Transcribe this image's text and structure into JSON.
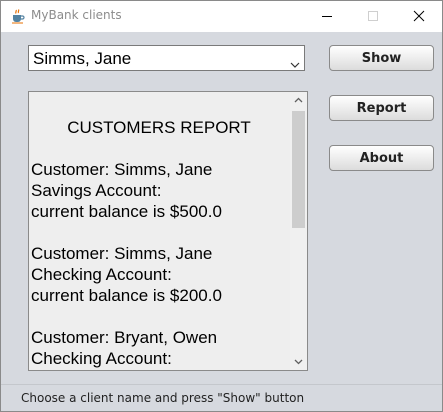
{
  "window": {
    "title": "MyBank clients",
    "icon": "java-cup-icon"
  },
  "title_controls": {
    "minimize_icon": "minimize-icon",
    "maximize_icon": "maximize-icon",
    "close_icon": "close-icon"
  },
  "client_select": {
    "selected": "Simms, Jane",
    "arrow_icon": "chevron-down-icon"
  },
  "buttons": {
    "show": "Show",
    "report": "Report",
    "about": "About"
  },
  "report": {
    "heading": "CUSTOMERS REPORT",
    "entries": [
      {
        "customer": "Customer: Simms, Jane",
        "account": "Savings Account:",
        "balance": "current balance is $500.0"
      },
      {
        "customer": "Customer: Simms, Jane",
        "account": "Checking Account:",
        "balance": "current balance is $200.0"
      },
      {
        "customer": "Customer: Bryant, Owen",
        "account": "Checking Account:",
        "balance": ""
      }
    ]
  },
  "status_bar": {
    "text": "Choose a client name and press \"Show\" button"
  },
  "colors": {
    "window_bg": "#d6d9df",
    "report_bg": "#eeeeee",
    "title_text": "#8c8c8c"
  }
}
